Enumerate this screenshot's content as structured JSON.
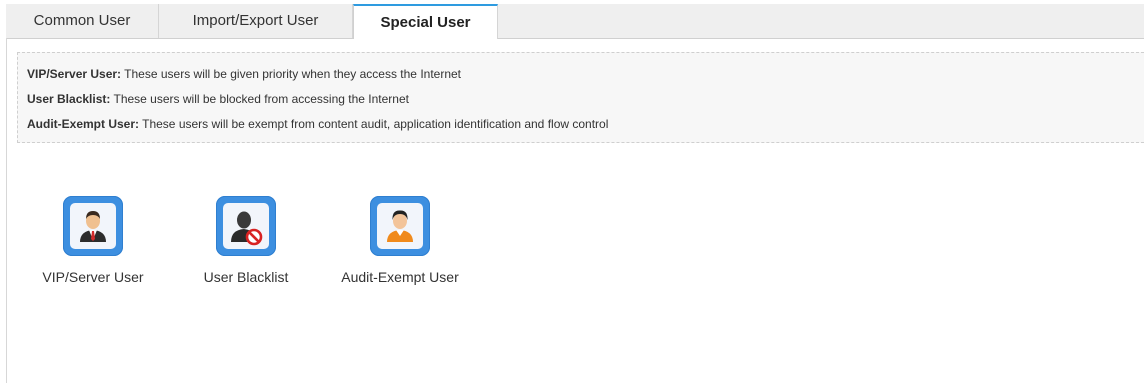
{
  "tabs": [
    {
      "label": "Common User",
      "active": false
    },
    {
      "label": "Import/Export User",
      "active": false
    },
    {
      "label": "Special User",
      "active": true
    }
  ],
  "info": {
    "vip": {
      "term": "VIP/Server User:",
      "text": " These users will be given priority when they access the Internet"
    },
    "blacklist": {
      "term": "User Blacklist:",
      "text": " These users will be blocked from accessing the Internet"
    },
    "audit": {
      "term": "Audit-Exempt User:",
      "text": " These users will be exempt from content audit, application identification and flow control"
    }
  },
  "users": [
    {
      "label": "VIP/Server User",
      "icon": "vip-user-icon"
    },
    {
      "label": "User Blacklist",
      "icon": "blocked-user-icon"
    },
    {
      "label": "Audit-Exempt User",
      "icon": "audit-exempt-user-icon"
    }
  ],
  "colors": {
    "tile": "#3d8fe0",
    "active_tab_accent": "#2e9be0",
    "info_bg": "#f7f7f7"
  }
}
